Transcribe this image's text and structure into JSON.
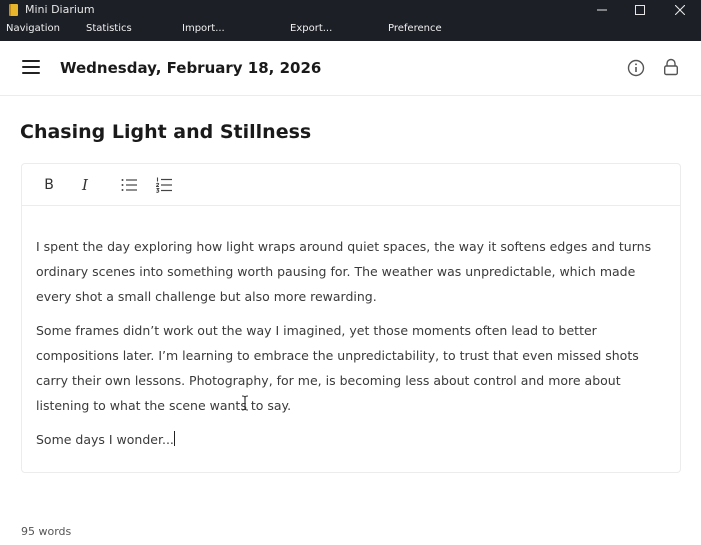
{
  "window": {
    "title": "Mini Diarium"
  },
  "menu": [
    "Navigation",
    "Statistics",
    "Import...",
    "Export...",
    "Preference"
  ],
  "header": {
    "date": "Wednesday, February 18, 2026"
  },
  "entry": {
    "title": "Chasing Light and Stillness",
    "paragraphs": [
      "I spent the day exploring how light wraps around quiet spaces, the way it softens edges and turns ordinary scenes into something worth pausing for. The weather was unpredictable, which made every shot a small challenge but also more rewarding.",
      "Some frames didn’t work out the way I imagined, yet those moments often lead to better compositions later. I’m learning to embrace the unpredictability, to trust that even missed shots carry their own lessons. Photography, for me, is becoming less about control and more about listening to what the scene wants to say.",
      "Some days I wonder..."
    ]
  },
  "toolbar": {
    "bold": "B",
    "italic": "I"
  },
  "footer": {
    "word_count": "95 words"
  },
  "icons": {
    "menu": "hamburger-icon",
    "info": "info-icon",
    "lock": "lock-icon",
    "bullet_list": "bullet-list-icon",
    "numbered_list": "numbered-list-icon"
  },
  "colors": {
    "titlebar": "#1c1f26",
    "app_icon": "#e7b52c",
    "text": "#1a1a1a",
    "body_text": "#3a3a3a"
  }
}
